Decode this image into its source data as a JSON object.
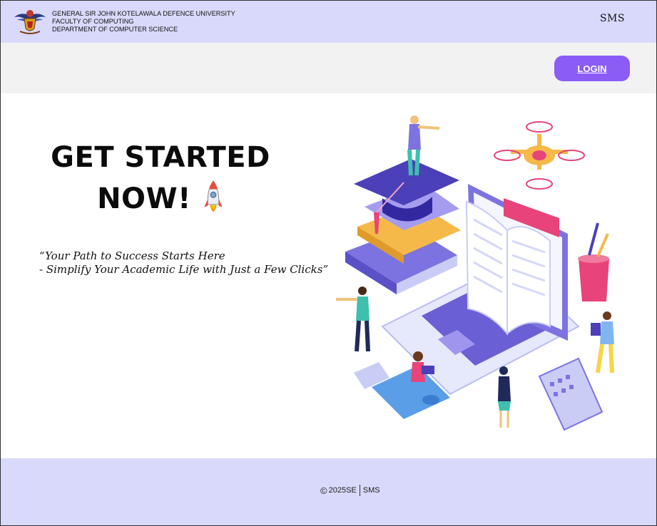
{
  "header": {
    "university_lines": [
      "GENERAL SIR JOHN KOTELAWALA DEFENCE UNIVERSITY",
      "FACULTY OF COMPUTING",
      "DEPARTMENT OF COMPUTER SCIENCE"
    ],
    "brand": "SMS",
    "logo_icon": "university-crest-icon"
  },
  "subbar": {
    "login_label": "LOGIN"
  },
  "hero": {
    "title_line1": "GET STARTED",
    "title_line2": "NOW!",
    "rocket_icon": "rocket-icon",
    "tagline_line1": "“Your Path to Success Starts Here",
    "tagline_line2": "- Simplify Your Academic Life with Just a Few Clicks”",
    "illustration": "education-laptop-books-students-illustration"
  },
  "footer": {
    "copyright_icon": "copyright-icon",
    "year_text": "2025SE",
    "brand": "SMS"
  },
  "colors": {
    "header_bg": "#d8d9fb",
    "subbar_bg": "#f2f2f2",
    "accent": "#8b5cf6",
    "footer_bg": "#d8d9fb"
  }
}
